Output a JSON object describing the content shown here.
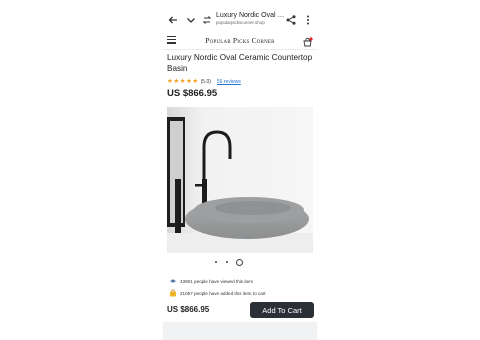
{
  "browser": {
    "page_title": "Luxury Nordic Oval Ce...",
    "url": "popularpickscorner.shop",
    "icons": [
      "back-arrow-icon",
      "chevron-down-icon",
      "tabs-icon",
      "share-icon",
      "more-vert-icon"
    ]
  },
  "site": {
    "name": "Popular Picks Corner",
    "icons": [
      "menu-icon",
      "cart-icon"
    ]
  },
  "product": {
    "title": "Luxury Nordic Oval Ceramic Countertop Basin",
    "rating_display": "(5.0)",
    "rating_value": 5,
    "reviews": "56 reviews",
    "price": "US $866.95",
    "image_alt": "basin-product-photo",
    "carousel": {
      "total": 3,
      "active_index": 2
    }
  },
  "social_proof": {
    "viewed": "43901 people have viewed this item",
    "added": "21057 people have added this item to cart"
  },
  "footer": {
    "price": "US $866.95",
    "add_to_cart": "Add To Cart"
  },
  "colors": {
    "star": "#f0a020",
    "link": "#2a74d6",
    "button": "#2b2f36",
    "cart_badge": "#e0242a"
  }
}
